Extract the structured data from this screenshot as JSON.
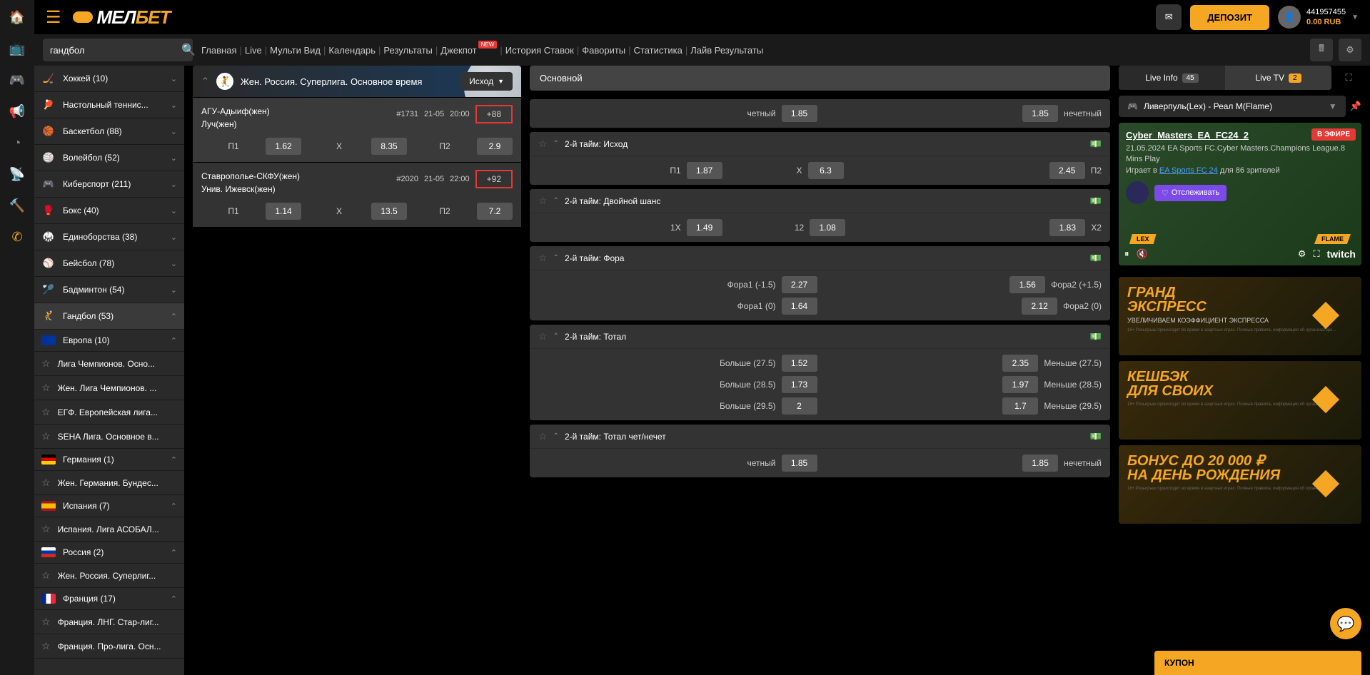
{
  "header": {
    "logo": "МЕЛБЕТ",
    "deposit": "ДЕПОЗИТ",
    "user_id": "441957455",
    "balance": "0.00 RUB"
  },
  "search": {
    "value": "гандбол"
  },
  "nav": {
    "main": "Главная",
    "live": "Live",
    "multi": "Мульти Вид",
    "calendar": "Календарь",
    "results": "Результаты",
    "jackpot": "Джекпот",
    "history": "История Ставок",
    "favorites": "Фавориты",
    "stats": "Статистика",
    "liveresults": "Лайв Результаты",
    "new": "NEW"
  },
  "sidebar": {
    "sports": [
      {
        "label": "Хоккей (10)",
        "ico": "🏒"
      },
      {
        "label": "Настольный теннис...",
        "ico": "🏓"
      },
      {
        "label": "Баскетбол (88)",
        "ico": "🏀"
      },
      {
        "label": "Волейбол (52)",
        "ico": "🏐"
      },
      {
        "label": "Киберспорт (211)",
        "ico": "🎮"
      },
      {
        "label": "Бокс (40)",
        "ico": "🥊"
      },
      {
        "label": "Единоборства (38)",
        "ico": "🥋"
      },
      {
        "label": "Бейсбол (78)",
        "ico": "⚾"
      },
      {
        "label": "Бадминтон (54)",
        "ico": "🏸"
      },
      {
        "label": "Гандбол (53)",
        "ico": "🤾"
      }
    ],
    "regions": [
      {
        "label": "Европа (10)",
        "flag": "eu"
      },
      {
        "sub": "Лига Чемпионов. Осно..."
      },
      {
        "sub": "Жен. Лига Чемпионов. ..."
      },
      {
        "sub": "ЕГФ. Европейская лига..."
      },
      {
        "sub": "SEHA Лига. Основное в..."
      },
      {
        "label": "Германия (1)",
        "flag": "de"
      },
      {
        "sub": "Жен. Германия. Бундес..."
      },
      {
        "label": "Испания (7)",
        "flag": "es"
      },
      {
        "sub": "Испания. Лига АСОБАЛ..."
      },
      {
        "label": "Россия (2)",
        "flag": "ru"
      },
      {
        "sub": "Жен. Россия. Суперлиг..."
      },
      {
        "label": "Франция (17)",
        "flag": "fr"
      },
      {
        "sub": "Франция. ЛНГ. Стар-лиг..."
      },
      {
        "sub": "Франция. Про-лига. Осн..."
      }
    ]
  },
  "league": {
    "title": "Жен. Россия. Суперлига. Основное время",
    "filter": "Исход"
  },
  "matches": [
    {
      "team1": "АГУ-Адыиф(жен)",
      "team2": "Луч(жен)",
      "id": "#1731",
      "date": "21-05",
      "time": "20:00",
      "more": "+88",
      "odds": [
        {
          "l": "П1",
          "v": "1.62"
        },
        {
          "l": "X",
          "v": "8.35"
        },
        {
          "l": "П2",
          "v": "2.9"
        }
      ]
    },
    {
      "team1": "Ставрополье-СКФУ(жен)",
      "team2": "Унив. Ижевск(жен)",
      "id": "#2020",
      "date": "21-05",
      "time": "22:00",
      "more": "+92",
      "odds": [
        {
          "l": "П1",
          "v": "1.14"
        },
        {
          "l": "X",
          "v": "13.5"
        },
        {
          "l": "П2",
          "v": "7.2"
        }
      ]
    }
  ],
  "market_tab": "Основной",
  "markets": [
    {
      "title": "",
      "rows": [
        [
          {
            "l": "четный",
            "v": "1.85"
          },
          {
            "l": "нечетный",
            "v": "1.85"
          }
        ]
      ]
    },
    {
      "title": "2-й тайм: Исход",
      "rows": [
        [
          {
            "l": "П1",
            "v": "1.87"
          },
          {
            "l": "X",
            "v": "6.3"
          },
          {
            "l": "П2",
            "v": "2.45"
          }
        ]
      ]
    },
    {
      "title": "2-й тайм: Двойной шанс",
      "rows": [
        [
          {
            "l": "1X",
            "v": "1.49"
          },
          {
            "l": "12",
            "v": "1.08"
          },
          {
            "l": "X2",
            "v": "1.83"
          }
        ]
      ]
    },
    {
      "title": "2-й тайм: Фора",
      "rows": [
        [
          {
            "l": "Фора1 (-1.5)",
            "v": "2.27"
          },
          {
            "l": "Фора2 (+1.5)",
            "v": "1.56"
          }
        ],
        [
          {
            "l": "Фора1 (0)",
            "v": "1.64"
          },
          {
            "l": "Фора2 (0)",
            "v": "2.12"
          }
        ]
      ]
    },
    {
      "title": "2-й тайм: Тотал",
      "rows": [
        [
          {
            "l": "Больше (27.5)",
            "v": "1.52"
          },
          {
            "l": "Меньше (27.5)",
            "v": "2.35"
          }
        ],
        [
          {
            "l": "Больше (28.5)",
            "v": "1.73"
          },
          {
            "l": "Меньше (28.5)",
            "v": "1.97"
          }
        ],
        [
          {
            "l": "Больше (29.5)",
            "v": "2"
          },
          {
            "l": "Меньше (29.5)",
            "v": "1.7"
          }
        ]
      ]
    },
    {
      "title": "2-й тайм: Тотал чет/нечет",
      "rows": [
        [
          {
            "l": "четный",
            "v": "1.85"
          },
          {
            "l": "нечетный",
            "v": "1.85"
          }
        ]
      ]
    }
  ],
  "live": {
    "tab1": "Live Info",
    "tab1_badge": "45",
    "tab2": "Live TV",
    "tab2_badge": "2",
    "stream": "Ливерпуль(Lex) - Реал М(Flame)",
    "title": "Cyber_Masters_EA_FC24_2",
    "live_badge": "В ЭФИРЕ",
    "meta1": "21.05.2024 EA Sports FC.Cyber Masters.Champions League.8 Mins Play",
    "meta2_prefix": "Играет в ",
    "meta2_link": "EA Sports FC 24",
    "meta2_suffix": " для 86 зрителей",
    "follow": "Отслеживать",
    "team_l": "LEX",
    "team_r": "FLAME"
  },
  "promos": [
    {
      "t1": "ГРАНД",
      "t2": "ЭКСПРЕСС",
      "sub": "УВЕЛИЧИВАЕМ КОЭФФИЦИЕНТ ЭКСПРЕССА"
    },
    {
      "t1": "КЕШБЭК",
      "t2": "ДЛЯ СВОИХ",
      "sub": ""
    },
    {
      "t1": "БОНУС ДО 20 000 ₽",
      "t2": "НА ДЕНЬ РОЖДЕНИЯ",
      "sub": ""
    }
  ],
  "coupon": "КУПОН"
}
